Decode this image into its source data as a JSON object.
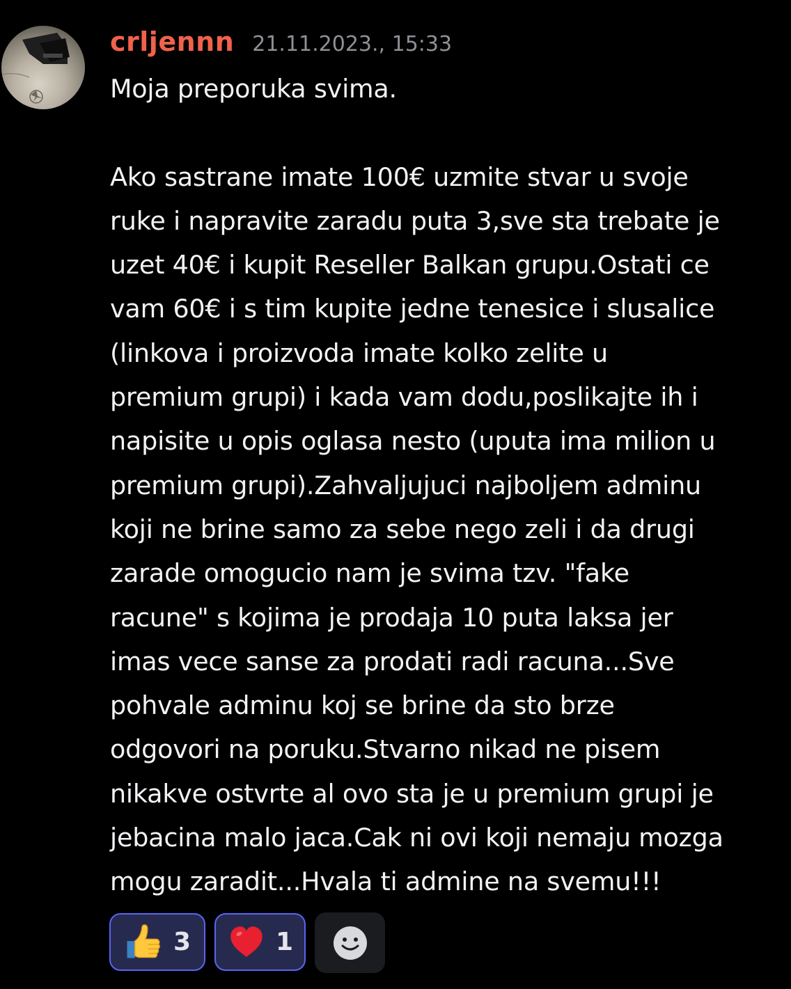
{
  "message": {
    "author": "crljennn",
    "timestamp": "21.11.2023., 15:33",
    "lines": [
      "Moja preporuka svima.",
      "",
      "Ako sastrane imate 100€ uzmite stvar u svoje",
      "ruke i napravite zaradu puta 3,sve sta trebate je",
      "uzet 40€ i kupit Reseller Balkan grupu.Ostati ce",
      "vam 60€ i s tim kupite jedne tenesice i slusalice",
      "(linkova i proizvoda imate kolko zelite u",
      "premium grupi) i kada vam dodu,poslikajte ih i",
      "napisite u opis oglasa nesto (uputa ima milion u",
      "premium grupi).Zahvaljujuci najboljem adminu",
      "koji ne brine samo za sebe nego zeli i da drugi",
      "zarade omogucio nam je svima tzv. \"fake",
      "racune\" s kojima je prodaja 10 puta laksa jer",
      "imas vece sanse za prodati radi racuna...Sve",
      "pohvale adminu koj se brine da sto brze",
      "odgovori na poruku.Stvarno nikad ne pisem",
      "nikakve ostvrte al ovo sta je u premium grupi je",
      "jebacina malo jaca.Cak ni ovi koji nemaju mozga",
      "mogu zaradit...Hvala ti admine na svemu!!!"
    ]
  },
  "reactions": [
    {
      "emoji": "thumbs-up-icon",
      "count": "3"
    },
    {
      "emoji": "heart-icon",
      "count": "1"
    }
  ],
  "add_reaction_icon": "smiley-icon",
  "colors": {
    "background": "#000000",
    "username": "#f0624b",
    "timestamp": "#8e9097",
    "text": "#f2f3f5",
    "reaction_border": "#5865f2",
    "reaction_bg": "#272a4f"
  }
}
